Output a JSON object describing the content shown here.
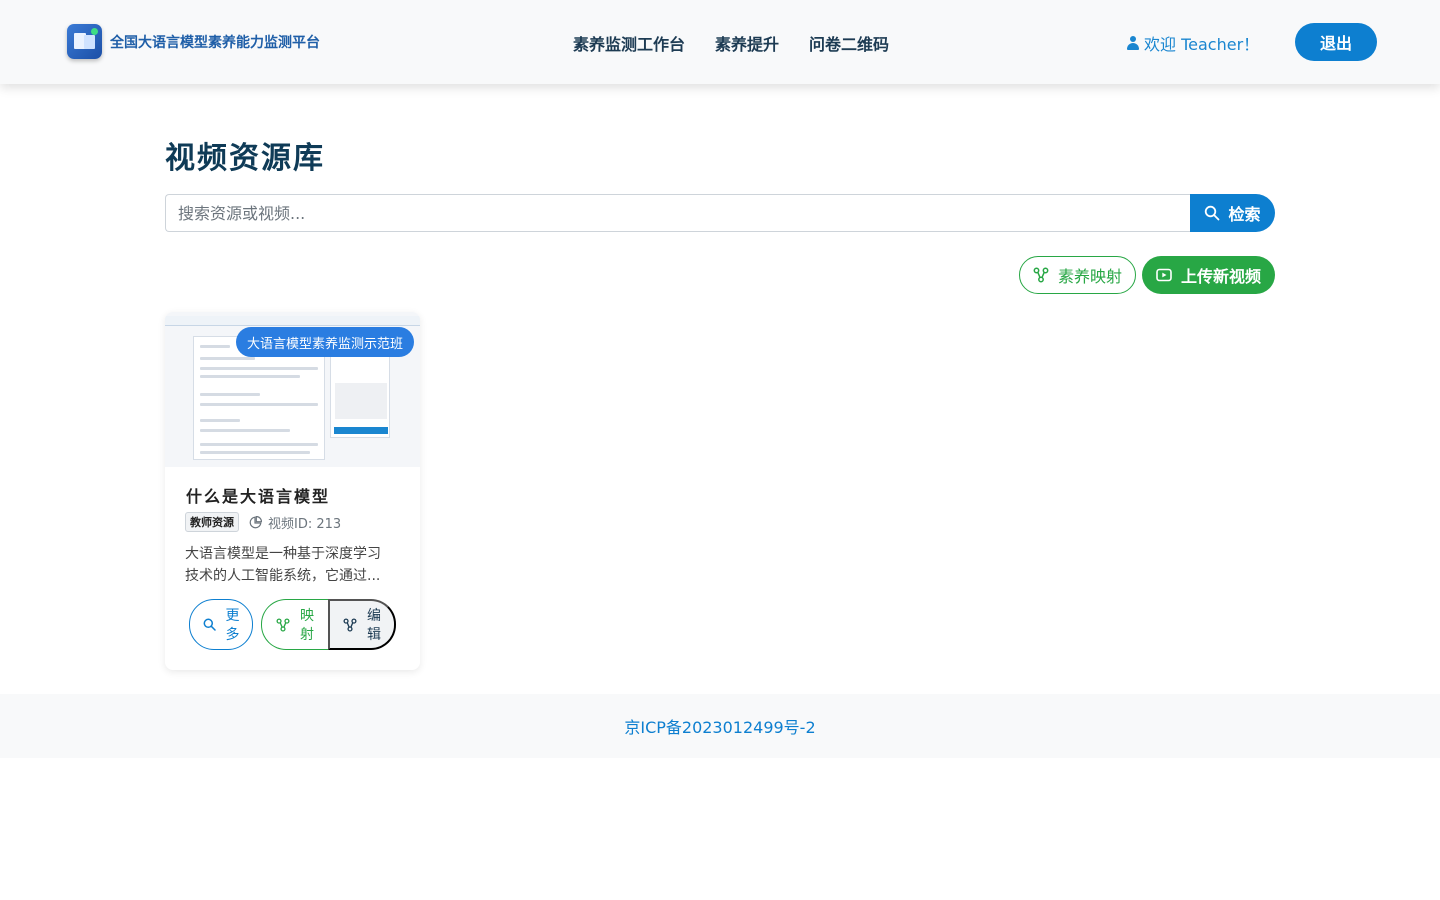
{
  "header": {
    "brand_title": "全国大语言模型素养能力监测平台",
    "nav": [
      "素养监测工作台",
      "素养提升",
      "问卷二维码"
    ],
    "welcome": "欢迎 Teacher！",
    "logout_label": "退出"
  },
  "main": {
    "page_title": "视频资源库",
    "search": {
      "placeholder": "搜索资源或视频...",
      "value": "",
      "button_label": "检索"
    },
    "map_button_label": "素养映射",
    "upload_button_label": "上传新视频"
  },
  "card": {
    "badge": "大语言模型素养监测示范班",
    "title": "什么是大语言模型",
    "tag": "教师资源",
    "video_id": "视频ID: 213",
    "description_line1": "大语言模型是一种基于深度学习",
    "description_line2": "技术的人工智能系统，它通过...",
    "actions": {
      "more": "更多",
      "map": "映射",
      "edit": "编辑"
    }
  },
  "footer": {
    "icp": "京ICP备2023012499号-2"
  },
  "colors": {
    "primary": "#0d7fd0",
    "success": "#28a745",
    "title": "#0f3b57"
  }
}
